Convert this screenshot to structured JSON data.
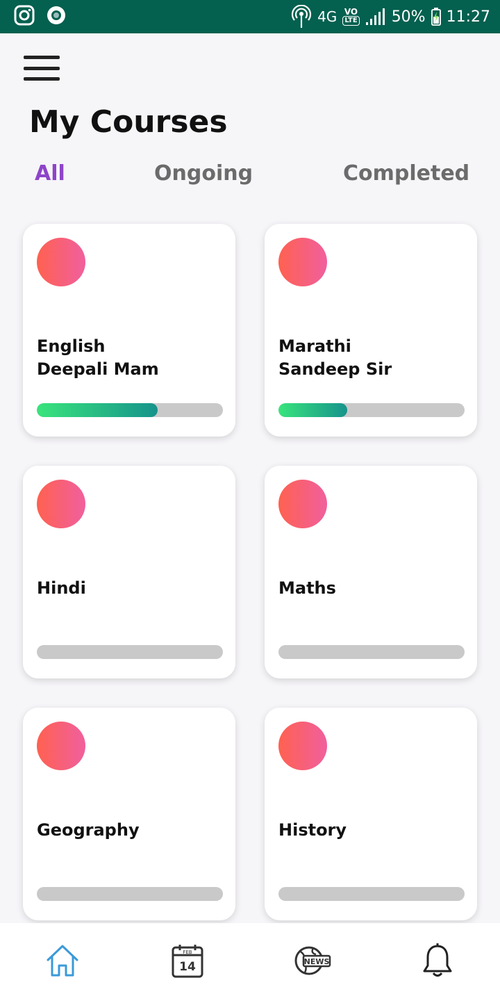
{
  "status_bar": {
    "network": "4G",
    "volte": "VO",
    "lte": "LTE",
    "battery": "50%",
    "time": "11:27"
  },
  "page": {
    "title": "My Courses"
  },
  "tabs": [
    {
      "label": "All",
      "active": true
    },
    {
      "label": "Ongoing",
      "active": false
    },
    {
      "label": "Completed",
      "active": false
    }
  ],
  "courses": [
    {
      "name": "English",
      "teacher": "Deepali Mam",
      "progress": 0.65
    },
    {
      "name": "Marathi",
      "teacher": "Sandeep Sir",
      "progress": 0.37
    },
    {
      "name": "Hindi",
      "teacher": "",
      "progress": 0
    },
    {
      "name": "Maths",
      "teacher": "",
      "progress": 0
    },
    {
      "name": "Geography",
      "teacher": "",
      "progress": 0
    },
    {
      "name": "History",
      "teacher": "",
      "progress": 0
    }
  ],
  "bottom_nav": {
    "items": [
      {
        "icon": "home-icon",
        "active": true
      },
      {
        "icon": "calendar-icon",
        "active": false
      },
      {
        "icon": "news-icon",
        "active": false
      },
      {
        "icon": "bell-icon",
        "active": false
      }
    ],
    "calendar_month": "FEB",
    "calendar_day": "14",
    "news_label": "NEWS"
  },
  "colors": {
    "status_bar": "#04604f",
    "tab_active": "#8e44c8",
    "tab_inactive": "#6b6b6b",
    "progress_start": "#39e47c",
    "progress_end": "#16938b",
    "avatar_start": "#ff6150",
    "avatar_end": "#f0609e",
    "home_icon": "#3a9ad9"
  }
}
